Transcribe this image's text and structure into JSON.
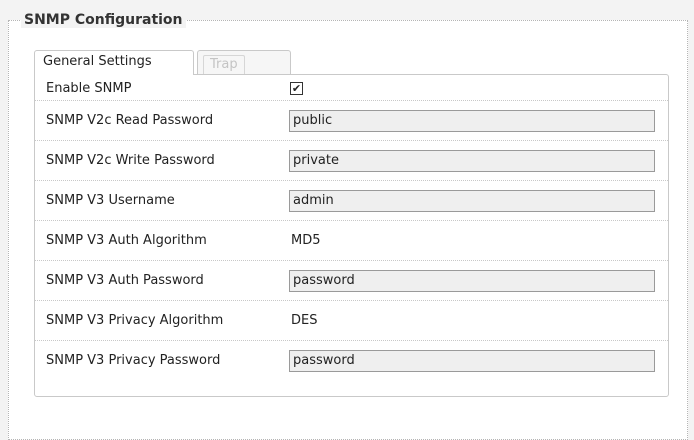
{
  "section": {
    "title": "SNMP Configuration"
  },
  "tabs": [
    {
      "label": "General Settings",
      "active": true
    },
    {
      "label": "Trap",
      "active": false
    }
  ],
  "fields": {
    "enable_snmp": {
      "label": "Enable SNMP",
      "checked": true,
      "check_glyph": "✔"
    },
    "v2c_read": {
      "label": "SNMP V2c Read Password",
      "value": "public"
    },
    "v2c_write": {
      "label": "SNMP V2c Write Password",
      "value": "private"
    },
    "v3_user": {
      "label": "SNMP V3 Username",
      "value": "admin"
    },
    "v3_auth_alg": {
      "label": "SNMP V3 Auth Algorithm",
      "value": "MD5"
    },
    "v3_auth_pw": {
      "label": "SNMP V3 Auth Password",
      "value": "password"
    },
    "v3_priv_alg": {
      "label": "SNMP V3 Privacy Algorithm",
      "value": "DES"
    },
    "v3_priv_pw": {
      "label": "SNMP V3 Privacy Password",
      "value": "password"
    }
  }
}
